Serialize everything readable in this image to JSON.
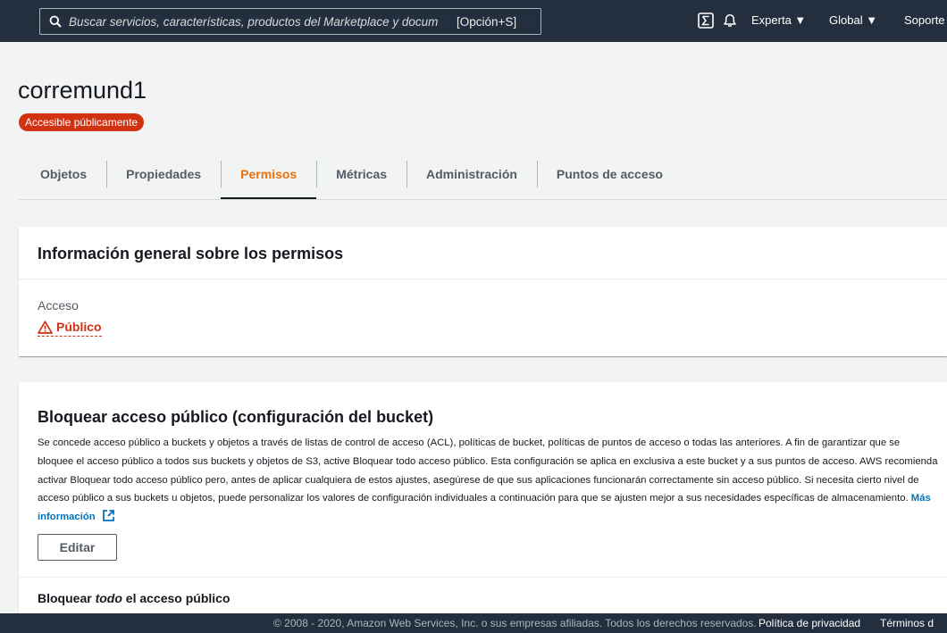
{
  "topnav": {
    "search_placeholder": "Buscar servicios, características, productos del Marketplace y docum",
    "search_shortcut": "[Opción+S]",
    "experience_menu": "Experta ▼",
    "region_menu": "Global ▼",
    "support_menu": "Soporte"
  },
  "bucket": {
    "name": "corremund1",
    "badge": "Accesible públicamente"
  },
  "tabs": [
    {
      "label": "Objetos"
    },
    {
      "label": "Propiedades"
    },
    {
      "label": "Permisos"
    },
    {
      "label": "Métricas"
    },
    {
      "label": "Administración"
    },
    {
      "label": "Puntos de acceso"
    }
  ],
  "overview": {
    "title": "Información general sobre los permisos",
    "access_label": "Acceso",
    "access_value": "Público"
  },
  "block_public": {
    "title": "Bloquear acceso público (configuración del bucket)",
    "description": "Se concede acceso público a buckets y objetos a través de listas de control de acceso (ACL), políticas de bucket, políticas de puntos de acceso o todas las anteriores. A fin de garantizar que se bloquee el acceso público a todos sus buckets y objetos de S3, active Bloquear todo acceso público. Esta configuración se aplica en exclusiva a este bucket y a sus puntos de acceso. AWS recomienda activar Bloquear todo acceso público pero, antes de aplicar cualquiera de estos ajustes, asegúrese de que sus aplicaciones funcionarán correctamente sin acceso público. Si necesita cierto nivel de acceso público a sus buckets u objetos, puede personalizar los valores de configuración individuales a continuación para que se ajusten mejor a sus necesidades específicas de almacenamiento.",
    "more_link": "Más información",
    "edit_button": "Editar",
    "sub_prefix": "Bloquear ",
    "sub_em": "todo",
    "sub_suffix": " el acceso público"
  },
  "footer": {
    "copyright": "© 2008 - 2020, Amazon Web Services, Inc. o sus empresas afiliadas. Todos los derechos reservados.",
    "privacy": "Política de privacidad",
    "terms": "Términos d"
  },
  "colors": {
    "nav_bg": "#232f3e",
    "active_tab": "#ec7211",
    "danger": "#d13212",
    "link": "#0073bb"
  }
}
